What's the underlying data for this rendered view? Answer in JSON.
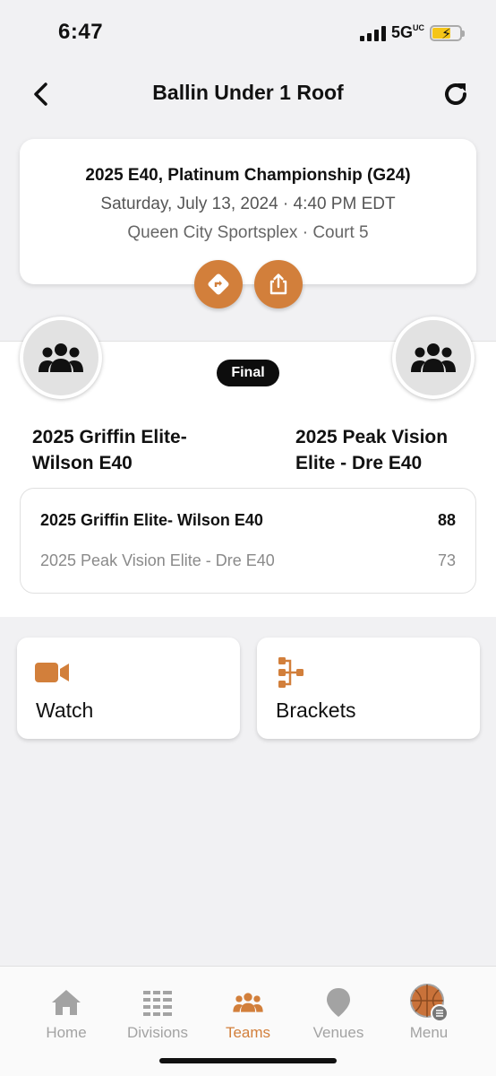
{
  "status_bar": {
    "time": "6:47",
    "network": "5G",
    "network_suffix": "UC"
  },
  "nav": {
    "title": "Ballin Under 1 Roof",
    "back_icon": "chevron-left-icon",
    "refresh_icon": "refresh-icon"
  },
  "game": {
    "title": "2025 E40, Platinum Championship (G24)",
    "datetime": "Saturday, July 13, 2024 · 4:40 PM EDT",
    "venue": "Queen City Sportsplex · Court 5",
    "directions_icon": "directions-icon",
    "share_icon": "share-icon"
  },
  "matchup": {
    "status": "Final",
    "home_team": {
      "name_line1": "2025 Griffin Elite-",
      "name_line2": "Wilson E40"
    },
    "away_team": {
      "name_line1": "2025 Peak Vision",
      "name_line2": "Elite - Dre E40"
    },
    "scores": [
      {
        "team": "2025 Griffin Elite- Wilson E40",
        "score": "88"
      },
      {
        "team": "2025 Peak Vision Elite - Dre E40",
        "score": "73"
      }
    ]
  },
  "tiles": {
    "watch_label": "Watch",
    "brackets_label": "Brackets"
  },
  "tab_bar": {
    "items": [
      {
        "label": "Home",
        "icon": "home-icon"
      },
      {
        "label": "Divisions",
        "icon": "divisions-icon"
      },
      {
        "label": "Teams",
        "icon": "teams-icon"
      },
      {
        "label": "Venues",
        "icon": "venue-pin-icon"
      },
      {
        "label": "Menu",
        "icon": "menu-basketball-icon"
      }
    ],
    "active": "Teams"
  },
  "colors": {
    "accent": "#d27f3b",
    "background": "#f1f1f3",
    "pill": "#0d0d0d",
    "inactive_tab": "#a3a3a3"
  }
}
